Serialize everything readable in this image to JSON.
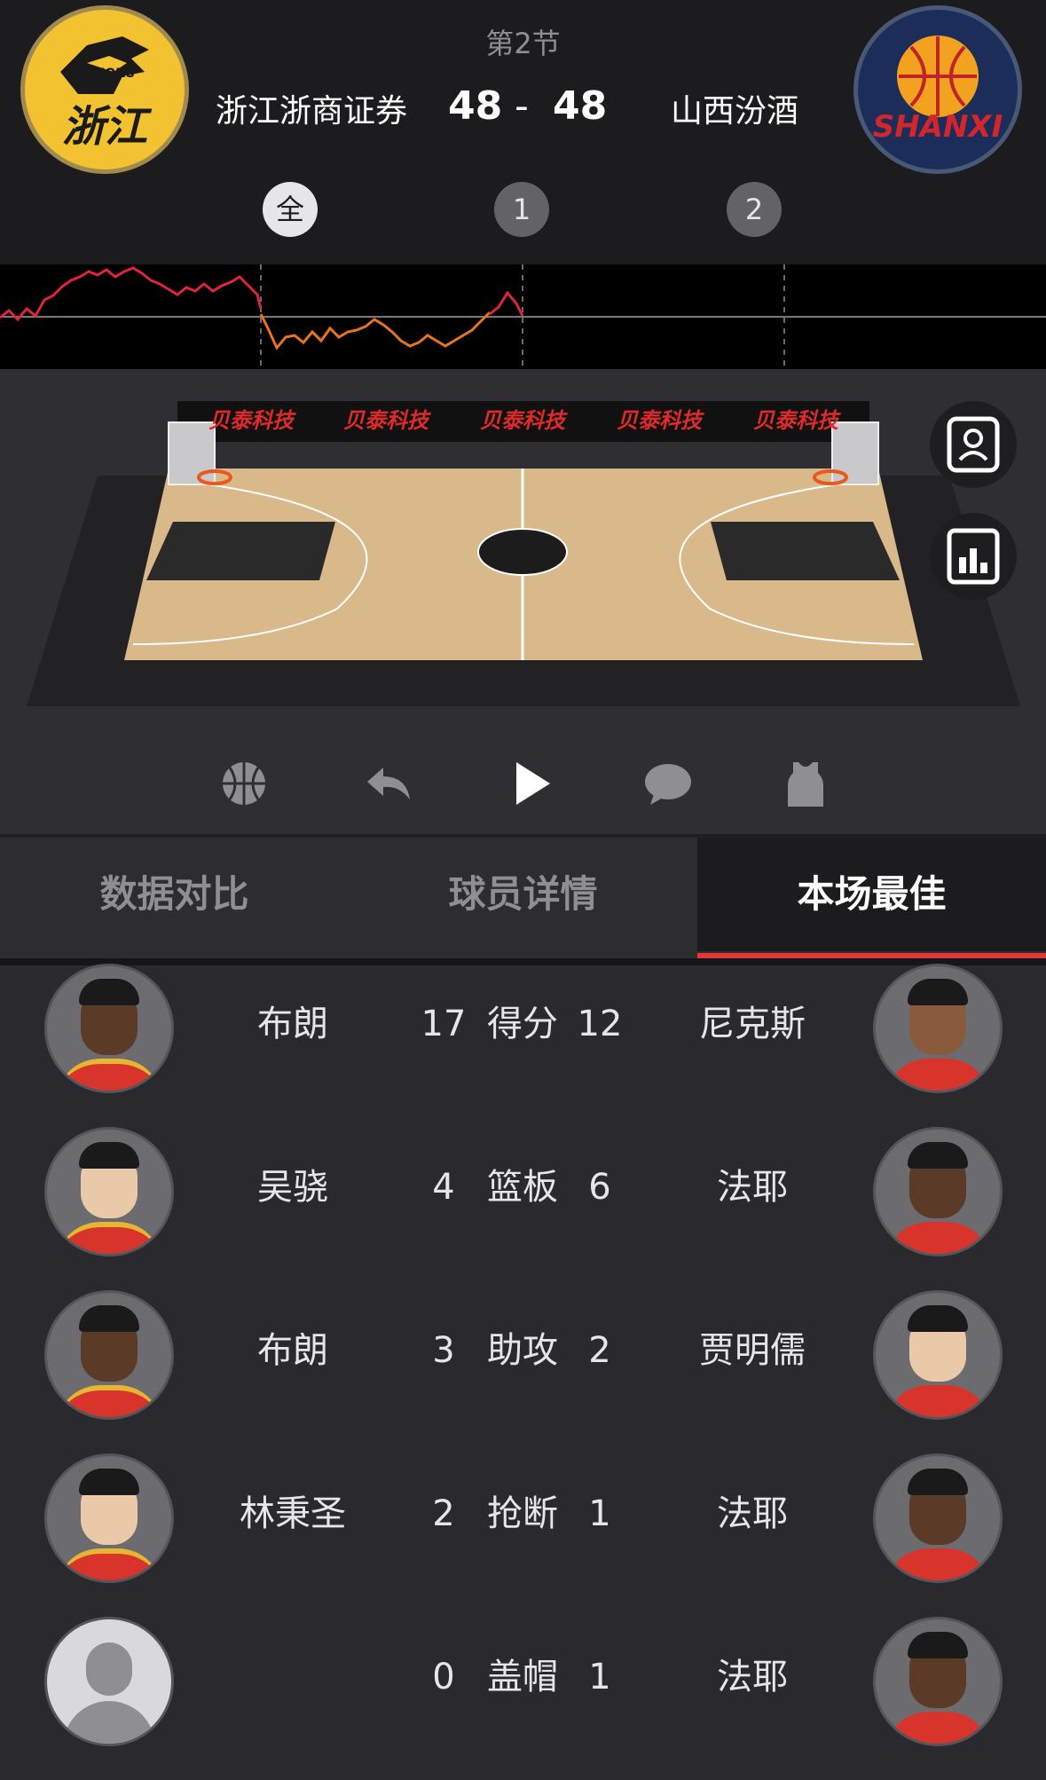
{
  "header": {
    "period": "第2节",
    "home": {
      "name": "浙江浙商证券",
      "score": "48",
      "logo_text": "浙江",
      "logo_sub": "ZJ LIONS"
    },
    "away": {
      "name": "山西汾酒",
      "score": "48",
      "logo_text": "SHANXI"
    },
    "separator": "-"
  },
  "quarter_tabs": [
    {
      "label": "全",
      "active": true
    },
    {
      "label": "1",
      "active": false
    },
    {
      "label": "2",
      "active": false
    }
  ],
  "court": {
    "ad_boards": [
      "贝泰科技",
      "贝泰科技",
      "贝泰科技",
      "贝泰科技",
      "贝泰科技"
    ],
    "side_buttons": [
      "contact-card-icon",
      "stats-chart-icon"
    ]
  },
  "controls": [
    "basketball-icon",
    "reply-arrow-icon",
    "play-icon",
    "chat-bubble-icon",
    "jersey-icon"
  ],
  "tabs": [
    {
      "label": "数据对比",
      "active": false
    },
    {
      "label": "球员详情",
      "active": false
    },
    {
      "label": "本场最佳",
      "active": true
    }
  ],
  "leaders": [
    {
      "home_player": "布朗",
      "home_value": "17",
      "stat": "得分",
      "away_value": "12",
      "away_player": "尼克斯"
    },
    {
      "home_player": "吴骁",
      "home_value": "4",
      "stat": "篮板",
      "away_value": "6",
      "away_player": "法耶"
    },
    {
      "home_player": "布朗",
      "home_value": "3",
      "stat": "助攻",
      "away_value": "2",
      "away_player": "贾明儒"
    },
    {
      "home_player": "林秉圣",
      "home_value": "2",
      "stat": "抢断",
      "away_value": "1",
      "away_player": "法耶"
    },
    {
      "home_player": "",
      "home_value": "0",
      "stat": "盖帽",
      "away_value": "1",
      "away_player": "法耶"
    }
  ],
  "colors": {
    "accent": "#e3353a",
    "trend_home": "#e0243a",
    "trend_away": "#e8741c",
    "header_bg": "#1c1c1e",
    "content_bg": "#2a2a2e"
  }
}
